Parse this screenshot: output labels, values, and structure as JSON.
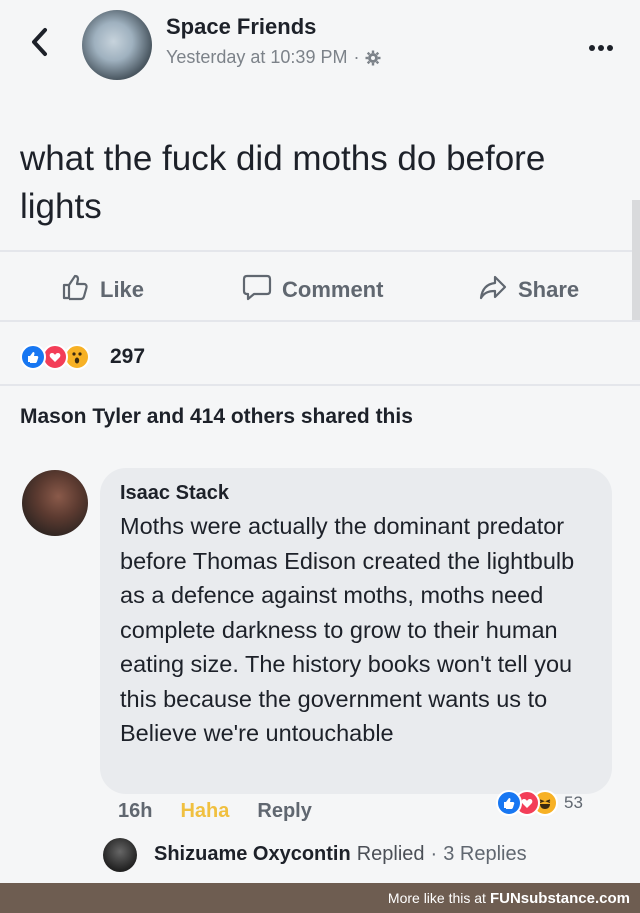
{
  "header": {
    "back_icon": "chevron-left-icon",
    "page_name": "Space Friends",
    "timestamp": "Yesterday at 10:39 PM",
    "separator": "·",
    "privacy_icon": "gear-icon",
    "more_icon": "more-horizontal-icon"
  },
  "post": {
    "text": "what the fuck did moths do before lights"
  },
  "actions": {
    "like": "Like",
    "comment": "Comment",
    "share": "Share"
  },
  "reactions": {
    "icons": [
      "like-reaction-icon",
      "love-reaction-icon",
      "wow-reaction-icon"
    ],
    "count": "297"
  },
  "shares": {
    "text": "Mason Tyler and 414 others shared this"
  },
  "comment": {
    "author": "Isaac Stack",
    "text": "Moths were actually the dominant predator before Thomas Edison created the lightbulb as a defence against moths, moths need complete darkness to grow to their human eating size. The history books won't tell you this because the government wants us to Believe we're untouchable",
    "time": "16h",
    "reaction_label": "Haha",
    "reply_label": "Reply",
    "reaction_icons": [
      "like-reaction-icon",
      "love-reaction-icon",
      "haha-reaction-icon"
    ],
    "reaction_count": "53"
  },
  "reply_summary": {
    "name": "Shizuame Oxycontin",
    "action": "Replied",
    "separator": "·",
    "count": "3 Replies"
  },
  "watermark": {
    "prefix": "More like this at",
    "brand_a": "FUN",
    "brand_b": "substance",
    "brand_c": ".com"
  },
  "colors": {
    "background": "#f5f6f7",
    "text": "#1d2129",
    "muted": "#606770",
    "haha": "#f0c040",
    "like_blue": "#1877f2",
    "love_red": "#f33e58",
    "wow_yellow": "#f7b125",
    "footer": "#6e5d51"
  }
}
